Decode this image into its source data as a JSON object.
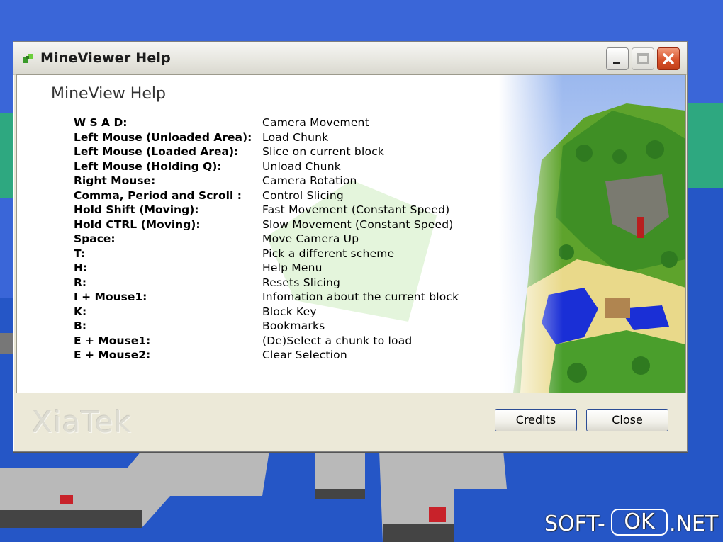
{
  "window": {
    "title": "MineViewer Help",
    "controls": {
      "minimize": "minimize",
      "maximize": "maximize",
      "close": "close"
    }
  },
  "help": {
    "heading": "MineView Help",
    "shortcuts": [
      {
        "key": "W S A D:",
        "action": "Camera Movement"
      },
      {
        "key": "Left Mouse (Unloaded Area):",
        "action": "Load Chunk"
      },
      {
        "key": "Left Mouse (Loaded Area):",
        "action": "Slice on current block"
      },
      {
        "key": "Left Mouse (Holding Q):",
        "action": "Unload Chunk"
      },
      {
        "key": "Right Mouse:",
        "action": "Camera Rotation"
      },
      {
        "key": "Comma, Period and Scroll :",
        "action": "Control Slicing"
      },
      {
        "key": "Hold Shift (Moving):",
        "action": "Fast Movement (Constant Speed)"
      },
      {
        "key": "Hold CTRL (Moving):",
        "action": "Slow Movement (Constant Speed)"
      },
      {
        "key": "Space:",
        "action": "Move Camera Up"
      },
      {
        "key": "T:",
        "action": "Pick a different scheme"
      },
      {
        "key": "H:",
        "action": "Help Menu"
      },
      {
        "key": "R:",
        "action": "Resets Slicing"
      },
      {
        "key": "I + Mouse1:",
        "action": "Infomation about the current block"
      },
      {
        "key": "K:",
        "action": "Block Key"
      },
      {
        "key": "B:",
        "action": "Bookmarks"
      },
      {
        "key": "E + Mouse1:",
        "action": "(De)Select a chunk to load"
      },
      {
        "key": "E + Mouse2:",
        "action": "Clear Selection"
      }
    ]
  },
  "footer": {
    "logo": "XiaTek",
    "credits_label": "Credits",
    "close_label": "Close"
  },
  "watermark": {
    "left": "SOFT-",
    "middle": "OK",
    "right": ".NET"
  },
  "colors": {
    "sky": "#3a66d8",
    "water": "#1e4ea0",
    "grass": "#2ea880",
    "close_button": "#d8532c"
  }
}
